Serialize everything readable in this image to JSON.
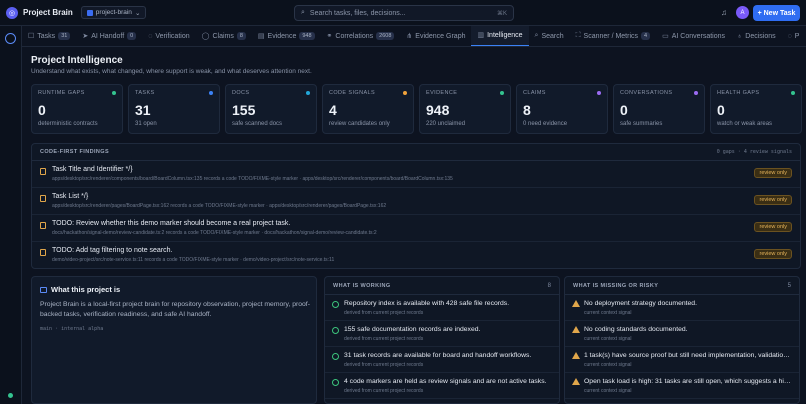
{
  "app": {
    "logo": "◎",
    "title": "Project Brain",
    "project": "project-brain"
  },
  "search": {
    "placeholder": "Search tasks, files, decisions...",
    "shortcut": "⌘K"
  },
  "header_actions": {
    "avatar_initial": "A",
    "new_task_label": "+ New Task"
  },
  "tabs": [
    {
      "icon": "check-square-icon",
      "glyph": "☐",
      "label": "Tasks",
      "badge": "31"
    },
    {
      "icon": "send-icon",
      "glyph": "➤",
      "label": "AI Handoff",
      "badge": "0"
    },
    {
      "icon": "check-circle-icon",
      "glyph": "◌",
      "label": "Verification",
      "badge": ""
    },
    {
      "icon": "shield-icon",
      "glyph": "◯",
      "label": "Claims",
      "badge": "8"
    },
    {
      "icon": "file-icon",
      "glyph": "▤",
      "label": "Evidence",
      "badge": "948"
    },
    {
      "icon": "link-icon",
      "glyph": "⚭",
      "label": "Correlations",
      "badge": "2608"
    },
    {
      "icon": "graph-icon",
      "glyph": "⋔",
      "label": "Evidence Graph",
      "badge": ""
    },
    {
      "icon": "chart-icon",
      "glyph": "▥",
      "label": "Intelligence",
      "badge": "",
      "active": true
    },
    {
      "icon": "search-icon",
      "glyph": "⌕",
      "label": "Search",
      "badge": ""
    },
    {
      "icon": "scanner-icon",
      "glyph": "⛶",
      "label": "Scanner / Metrics",
      "badge": "4"
    },
    {
      "icon": "chat-icon",
      "glyph": "▭",
      "label": "AI Conversations",
      "badge": ""
    },
    {
      "icon": "bulb-icon",
      "glyph": "♁",
      "label": "Decisions",
      "badge": ""
    },
    {
      "icon": "circle-icon",
      "glyph": "◌",
      "label": "P",
      "badge": ""
    }
  ],
  "page": {
    "title": "Project Intelligence",
    "subtitle": "Understand what exists, what changed, where support is weak, and what deserves attention next."
  },
  "stats": [
    {
      "label": "RUNTIME GAPS",
      "value": "0",
      "note": "deterministic contracts",
      "color": "#34c38f"
    },
    {
      "label": "TASKS",
      "value": "31",
      "note": "31 open",
      "color": "#3b82f6"
    },
    {
      "label": "DOCS",
      "value": "155",
      "note": "safe scanned docs",
      "color": "#22a6d8"
    },
    {
      "label": "CODE SIGNALS",
      "value": "4",
      "note": "review candidates only",
      "color": "#f0a23b"
    },
    {
      "label": "EVIDENCE",
      "value": "948",
      "note": "220 unclaimed",
      "color": "#34c38f"
    },
    {
      "label": "CLAIMS",
      "value": "8",
      "note": "0 need evidence",
      "color": "#9b6bf2"
    },
    {
      "label": "CONVERSATIONS",
      "value": "0",
      "note": "safe summaries",
      "color": "#9b6bf2"
    },
    {
      "label": "HEALTH GAPS",
      "value": "0",
      "note": "watch or weak areas",
      "color": "#34c38f"
    }
  ],
  "findings": {
    "title": "CODE-FIRST FINDINGS",
    "meta": "0 gaps · 4 review signals",
    "items": [
      {
        "title": "Task Title and Identifier */}",
        "path": "apps/desktop/src/renderer/components/board/BoardColumn.tsx:135 records a code TODO/FIXME-style marker · apps/desktop/src/renderer/components/board/BoardColumn.tsx:135",
        "badge": "review only"
      },
      {
        "title": "Task List */}",
        "path": "apps/desktop/src/renderer/pages/BoardPage.tsx:162 records a code TODO/FIXME-style marker · apps/desktop/src/renderer/pages/BoardPage.tsx:162",
        "badge": "review only"
      },
      {
        "title": "TODO: Review whether this demo marker should become a real project task.",
        "path": "docs/hackathon/signal-demo/review-candidate.ts:2 records a code TODO/FIXME-style marker · docs/hackathon/signal-demo/review-candidate.ts:2",
        "badge": "review only"
      },
      {
        "title": "TODO: Add tag filtering to note search.",
        "path": "demo/video-project/src/note-service.ts:11 records a code TODO/FIXME-style marker · demo/video-project/src/note-service.ts:11",
        "badge": "review only"
      }
    ]
  },
  "about": {
    "title": "What this project is",
    "description": "Project Brain is a local-first project brain for repository observation, project memory, proof-backed tasks, verification readiness, and safe AI handoff.",
    "meta": "main · internal alpha"
  },
  "working": {
    "title": "WHAT IS WORKING",
    "count": "8",
    "items": [
      {
        "text": "Repository index is available with 428 safe file records.",
        "sub": "derived from current project records"
      },
      {
        "text": "155 safe documentation records are indexed.",
        "sub": "derived from current project records"
      },
      {
        "text": "31 task records are available for board and handoff workflows.",
        "sub": "derived from current project records"
      },
      {
        "text": "4 code markers are held as review signals and are not active tasks.",
        "sub": "derived from current project records"
      }
    ]
  },
  "missing": {
    "title": "WHAT IS MISSING OR RISKY",
    "count": "5",
    "items": [
      {
        "text": "No deployment strategy documented.",
        "sub": "current context signal"
      },
      {
        "text": "No coding standards documented.",
        "sub": "current context signal"
      },
      {
        "text": "1 task(s) have source proof but still need implementation, validation,...",
        "sub": "current context signal"
      },
      {
        "text": "Open task load is high: 31 tasks are still open, which suggests a hig...",
        "sub": "current context signal"
      }
    ]
  }
}
